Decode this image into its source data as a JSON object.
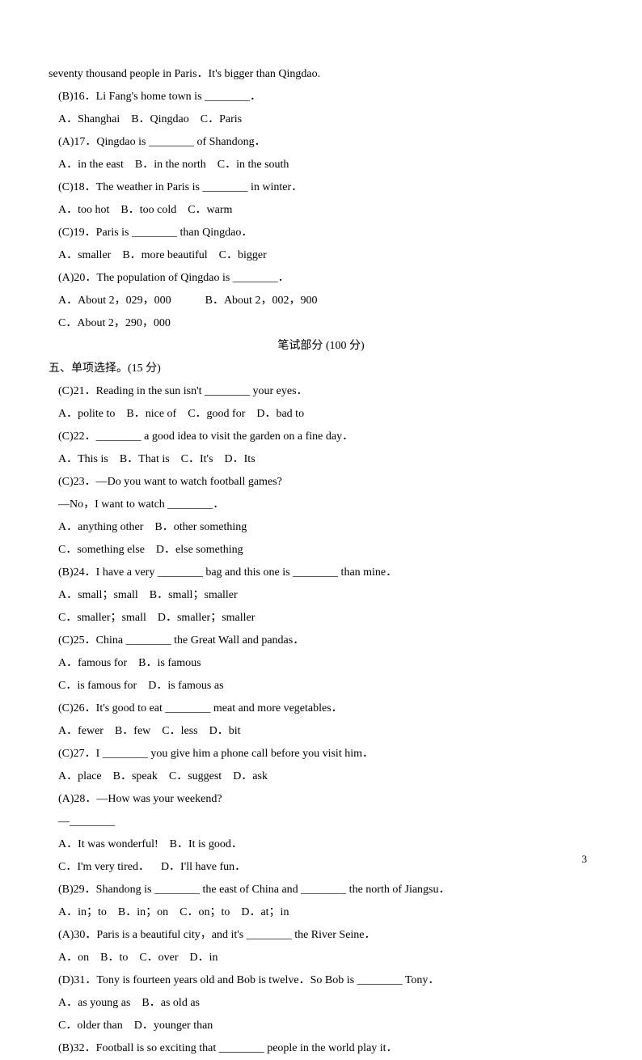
{
  "intro": "seventy thousand people in Paris．It's bigger than Qingdao.",
  "q16": {
    "prompt": "(B)16．Li Fang's home town is ________．",
    "opts": "A．Shanghai    B．Qingdao    C．Paris"
  },
  "q17": {
    "prompt": "(A)17．Qingdao is ________ of Shandong．",
    "opts": "A．in the east    B．in the north    C．in the south"
  },
  "q18": {
    "prompt": "(C)18．The weather in Paris is ________ in winter．",
    "opts": "A．too hot    B．too cold    C．warm"
  },
  "q19": {
    "prompt": "(C)19．Paris is ________ than Qingdao．",
    "opts": "A．smaller    B．more beautiful    C．bigger"
  },
  "q20": {
    "prompt": "(A)20．The population of Qingdao is ________．",
    "row1": "A．About 2，029，000            B．About 2，002，900",
    "row2": "C．About 2，290，000"
  },
  "written_title": "笔试部分 (100 分)",
  "section5": "五、单项选择。(15 分)",
  "q21": {
    "prompt": "(C)21．Reading in the sun isn't ________ your eyes．",
    "opts": "A．polite to    B．nice of    C．good for    D．bad to"
  },
  "q22": {
    "prompt": "(C)22．________ a good idea to visit the garden on a fine day．",
    "opts": "A．This is    B．That is    C．It's    D．Its"
  },
  "q23": {
    "prompt": "(C)23．—Do you want to watch football games?",
    "line2": "—No，I want to watch ________．",
    "row1": "A．anything other    B．other something",
    "row2": "C．something else    D．else something"
  },
  "q24": {
    "prompt": "(B)24．I have a very ________ bag and this one is ________ than mine．",
    "row1": "A．small；small    B．small；smaller",
    "row2": "C．smaller；small    D．smaller；smaller"
  },
  "q25": {
    "prompt": "(C)25．China ________ the Great Wall and pandas．",
    "row1": "A．famous for    B．is famous",
    "row2": "C．is famous for    D．is famous as"
  },
  "q26": {
    "prompt": "(C)26．It's good to eat ________ meat and more vegetables．",
    "opts": "A．fewer    B．few    C．less    D．bit"
  },
  "q27": {
    "prompt": "(C)27．I ________ you give him a phone call before you visit him．",
    "opts": "A．place    B．speak    C．suggest    D．ask"
  },
  "q28": {
    "prompt": "(A)28．—How was your weekend?",
    "line2": "—________",
    "row1": "A．It was wonderful!    B．It is good．",
    "row2": "C．I'm very tired．    D．I'll have fun．"
  },
  "q29": {
    "prompt": "(B)29．Shandong is ________ the east of China and ________ the north of Jiangsu．",
    "opts": "A．in；to    B．in；on    C．on；to    D．at；in"
  },
  "q30": {
    "prompt": "(A)30．Paris is a beautiful city，and it's ________ the River Seine．",
    "opts": "A．on    B．to    C．over    D．in"
  },
  "q31": {
    "prompt": "(D)31．Tony is fourteen years old and Bob is twelve．So Bob is ________ Tony．",
    "row1": "A．as young as    B．as old as",
    "row2": "C．older than    D．younger than"
  },
  "q32": {
    "prompt": "(B)32．Football is so exciting that ________ people in the world play it．"
  },
  "page_num": "3"
}
